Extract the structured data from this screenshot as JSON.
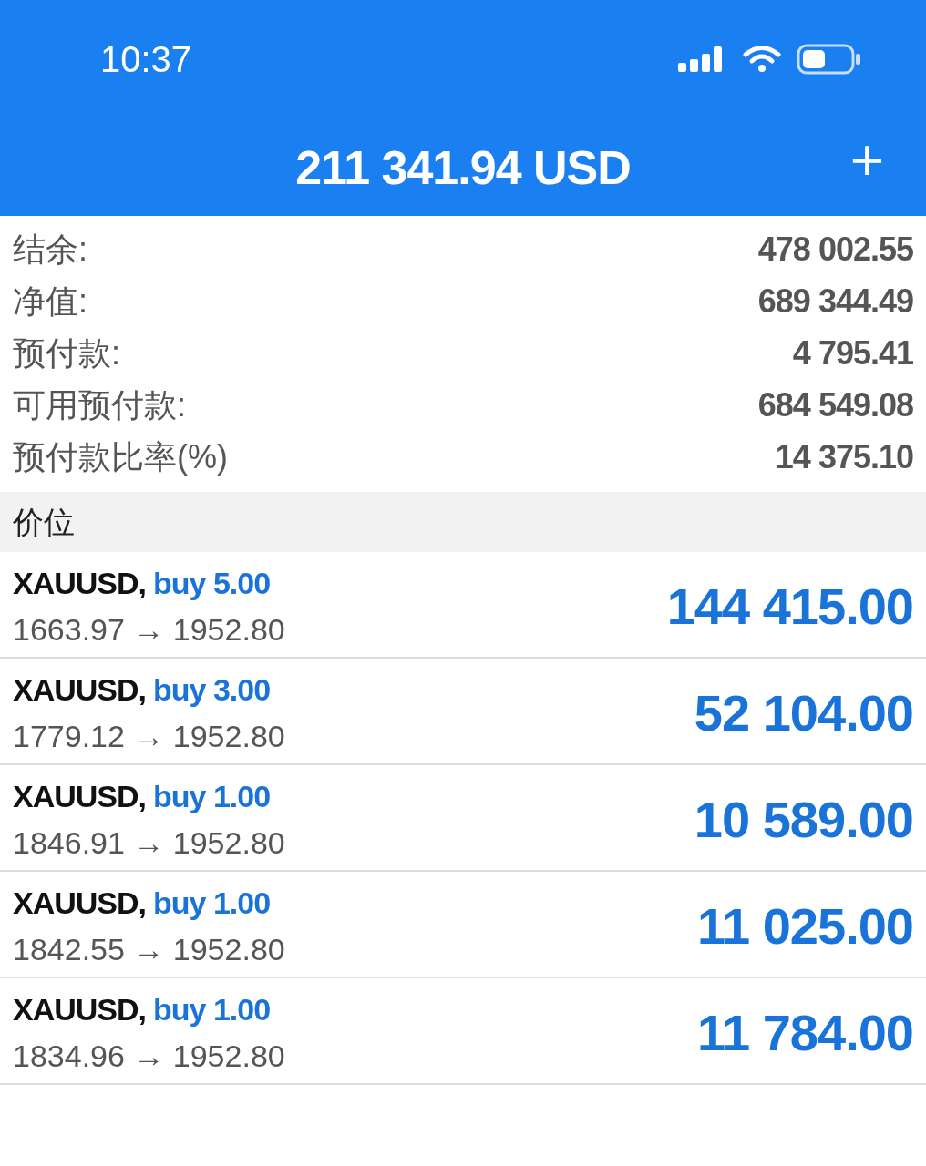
{
  "status_bar": {
    "time": "10:37"
  },
  "header": {
    "title": "211 341.94 USD",
    "add_button": "+"
  },
  "summary": [
    {
      "label": "结余:",
      "value": "478 002.55"
    },
    {
      "label": "净值:",
      "value": "689 344.49"
    },
    {
      "label": "预付款:",
      "value": "4 795.41"
    },
    {
      "label": "可用预付款:",
      "value": "684 549.08"
    },
    {
      "label": "预付款比率(%)",
      "value": "14 375.10"
    }
  ],
  "section": {
    "title": "价位"
  },
  "positions": [
    {
      "symbol": "XAUUSD,",
      "order": "buy 5.00",
      "prices": "1663.97 → 1952.80",
      "profit": "144 415.00"
    },
    {
      "symbol": "XAUUSD,",
      "order": "buy 3.00",
      "prices": "1779.12 → 1952.80",
      "profit": "52 104.00"
    },
    {
      "symbol": "XAUUSD,",
      "order": "buy 1.00",
      "prices": "1846.91 → 1952.80",
      "profit": "10 589.00"
    },
    {
      "symbol": "XAUUSD,",
      "order": "buy 1.00",
      "prices": "1842.55 → 1952.80",
      "profit": "11 025.00"
    },
    {
      "symbol": "XAUUSD,",
      "order": "buy 1.00",
      "prices": "1834.96 → 1952.80",
      "profit": "11 784.00"
    }
  ]
}
